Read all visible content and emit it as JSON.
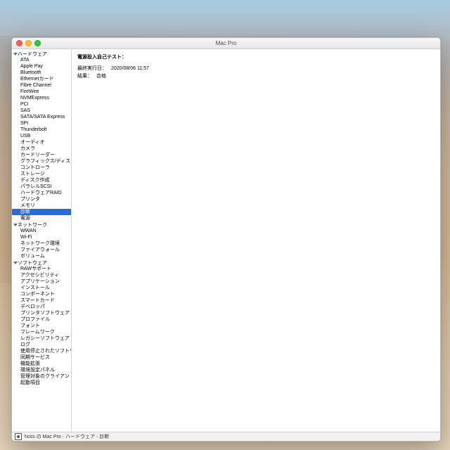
{
  "window": {
    "title": "Mac Pro"
  },
  "sidebar": {
    "sections": [
      {
        "label": "ハードウェア",
        "items": [
          "ATA",
          "Apple Pay",
          "Bluetooth",
          "Ethernetカード",
          "Fibre Channel",
          "FireWire",
          "NVMExpress",
          "PCI",
          "SAS",
          "SATA/SATA Express",
          "SPI",
          "Thunderbolt",
          "USB",
          "オーディオ",
          "カメラ",
          "カードリーダー",
          "グラフィックス/ディスプ…",
          "コントローラ",
          "ストレージ",
          "ディスク作成",
          "パラレルSCSI",
          "ハードウェアRAID",
          "プリンタ",
          "メモリ",
          "診断",
          "電源"
        ],
        "selectedIndex": 24
      },
      {
        "label": "ネットワーク",
        "items": [
          "WWAN",
          "Wi-Fi",
          "ネットワーク環境",
          "ファイアウォール",
          "ボリューム"
        ]
      },
      {
        "label": "ソフトウェア",
        "items": [
          "RAWサポート",
          "アクセシビリティ",
          "アプリケーション",
          "インストール",
          "コンポーネント",
          "スマートカード",
          "デベロッパ",
          "プリンタソフトウェア",
          "プロファイル",
          "フォント",
          "フレームワーク",
          "レガシーソフトウェア",
          "ログ",
          "使用停止されたソフトウェ…",
          "同期サービス",
          "機能拡張",
          "環境設定パネル",
          "管理対象のクライアント",
          "起動項目"
        ]
      }
    ]
  },
  "content": {
    "heading": "電源投入自己テスト：",
    "rows": [
      {
        "k": "最終実行日：",
        "v": "2020/08/06 11:57"
      },
      {
        "k": "結果：",
        "v": "合格"
      }
    ]
  },
  "statusbar": {
    "parts": [
      "hoss の Mac Pro",
      "ハードウェア",
      "診断"
    ]
  }
}
